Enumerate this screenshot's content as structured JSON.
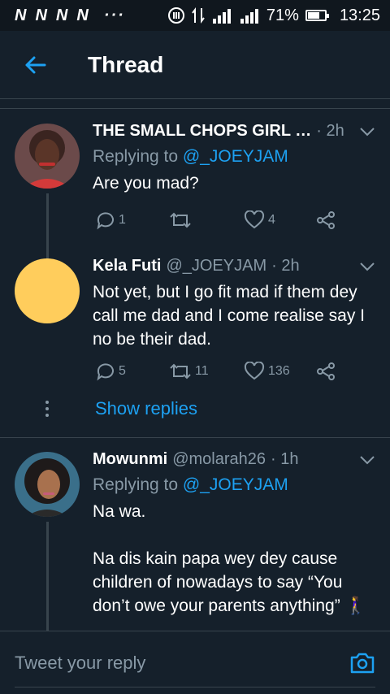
{
  "status_bar": {
    "carriers": [
      "N",
      "N",
      "N",
      "N"
    ],
    "dots": "···",
    "battery": "71%",
    "battery_level": 0.71,
    "time": "13:25"
  },
  "header": {
    "title": "Thread"
  },
  "tweets": [
    {
      "name": "THE SMALL CHOPS GIRL …",
      "handle": "",
      "time": "· 2h",
      "replying_prefix": "Replying to ",
      "replying_handle": "@_JOEYJAM",
      "text": "Are you mad?",
      "replies": "1",
      "retweets": "",
      "likes": "4"
    },
    {
      "name": "Kela Futi",
      "handle": "@_JOEYJAM",
      "time": "· 2h",
      "text": "Not yet, but I go fit mad if them dey call me dad and I come realise say I no be their dad.",
      "replies": "5",
      "retweets": "11",
      "likes": "136",
      "show_replies": "Show replies"
    },
    {
      "name": "Mowunmi",
      "handle": "@molarah26",
      "time": "· 1h",
      "replying_prefix": "Replying to ",
      "replying_handle": "@_JOEYJAM",
      "text": "Na wa.\n\nNa dis kain papa wey dey cause children of nowadays to say “You don’t owe your parents anything” 🚶‍♀️"
    }
  ],
  "compose": {
    "placeholder": "Tweet your reply"
  },
  "colors": {
    "accent": "#1da1f2",
    "background": "#15202b",
    "muted": "#8899a6"
  }
}
